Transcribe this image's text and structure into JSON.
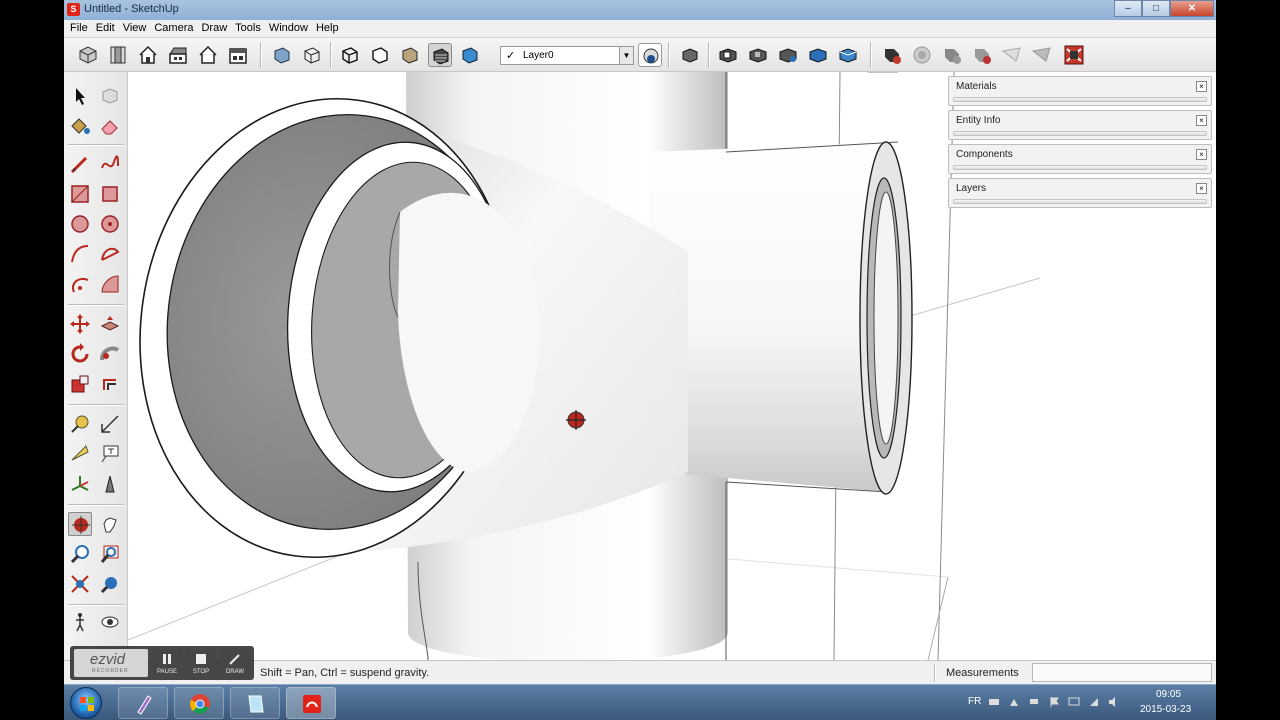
{
  "window": {
    "title": "Untitled - SketchUp",
    "minimize_glyph": "–",
    "maximize_glyph": "□",
    "close_glyph": "✕"
  },
  "menu": [
    "File",
    "Edit",
    "View",
    "Camera",
    "Draw",
    "Tools",
    "Window",
    "Help"
  ],
  "layer": {
    "check": "✓",
    "name": "Layer0",
    "arrow": "▼"
  },
  "trays": [
    {
      "title": "Materials"
    },
    {
      "title": "Entity Info"
    },
    {
      "title": "Components"
    },
    {
      "title": "Layers"
    }
  ],
  "tray_close_glyph": "×",
  "status": {
    "hint": "Shift = Pan, Ctrl = suspend gravity.",
    "measurements_label": "Measurements",
    "measurements_value": ""
  },
  "recorder": {
    "brand": "ezvid",
    "sub": "RECORDER",
    "buttons": [
      "PAUSE",
      "STOP",
      "DRAW"
    ]
  },
  "taskbar": {
    "language": "FR",
    "time": "09:05",
    "date": "2015-03-23"
  },
  "colors": {
    "accent": "#e2231a",
    "viewport_bg": "#ffffff",
    "chrome_bg": "#f0f0f0",
    "taskbar": "#3a587c"
  }
}
